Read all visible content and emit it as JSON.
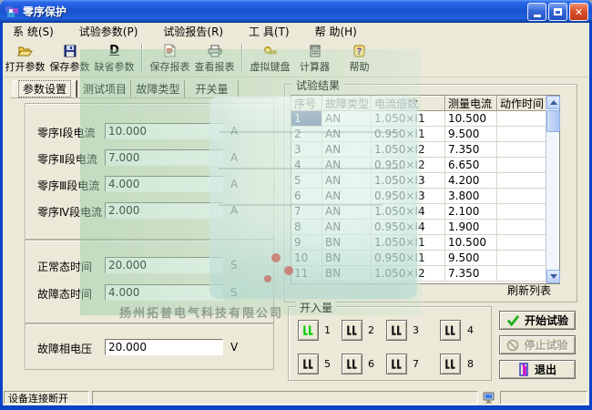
{
  "window": {
    "title": "零序保护"
  },
  "menu": {
    "items": [
      {
        "label": "系 统(S)"
      },
      {
        "label": "试验参数(P)"
      },
      {
        "label": "试验报告(R)"
      },
      {
        "label": "工 具(T)"
      },
      {
        "label": "帮 助(H)"
      }
    ]
  },
  "toolbar": {
    "buttons": [
      {
        "label": "打开参数",
        "icon": "open-folder-icon"
      },
      {
        "label": "保存参数",
        "icon": "save-icon"
      },
      {
        "label": "缺省参数",
        "icon": "default-params-icon"
      },
      {
        "label": "保存报表",
        "icon": "save-report-icon"
      },
      {
        "label": "查看报表",
        "icon": "print-report-icon"
      },
      {
        "label": "虚拟键盘",
        "icon": "virtual-keyboard-icon"
      },
      {
        "label": "计算器",
        "icon": "calculator-icon"
      },
      {
        "label": "帮助",
        "icon": "help-icon"
      }
    ]
  },
  "tabs": [
    {
      "label": "参数设置",
      "active": true
    },
    {
      "label": "测试项目",
      "active": false
    },
    {
      "label": "故障类型",
      "active": false
    },
    {
      "label": "开关量",
      "active": false
    }
  ],
  "params": {
    "current_fields": [
      {
        "label": "零序Ⅰ段电流",
        "value": "10.000",
        "unit": "A"
      },
      {
        "label": "零序Ⅱ段电流",
        "value": "7.000",
        "unit": "A"
      },
      {
        "label": "零序Ⅲ段电流",
        "value": "4.000",
        "unit": "A"
      },
      {
        "label": "零序Ⅳ段电流",
        "value": "2.000",
        "unit": "A"
      }
    ],
    "time_fields": [
      {
        "label": "正常态时间",
        "value": "20.000",
        "unit": "S"
      },
      {
        "label": "故障态时间",
        "value": "4.000",
        "unit": "S"
      }
    ],
    "voltage_fields": [
      {
        "label": "故障相电压",
        "value": "20.000",
        "unit": "V"
      }
    ]
  },
  "results": {
    "title": "试验结果",
    "columns": [
      "序号",
      "故障类型",
      "电流倍数",
      "测量电流",
      "动作时间"
    ],
    "rows": [
      [
        "1",
        "AN",
        "1.050×I1",
        "10.500",
        ""
      ],
      [
        "2",
        "AN",
        "0.950×I1",
        "9.500",
        ""
      ],
      [
        "3",
        "AN",
        "1.050×I2",
        "7.350",
        ""
      ],
      [
        "4",
        "AN",
        "0.950×I2",
        "6.650",
        ""
      ],
      [
        "5",
        "AN",
        "1.050×I3",
        "4.200",
        ""
      ],
      [
        "6",
        "AN",
        "0.950×I3",
        "3.800",
        ""
      ],
      [
        "7",
        "AN",
        "1.050×I4",
        "2.100",
        ""
      ],
      [
        "8",
        "AN",
        "0.950×I4",
        "1.900",
        ""
      ],
      [
        "9",
        "BN",
        "1.050×I1",
        "10.500",
        ""
      ],
      [
        "10",
        "BN",
        "0.950×I1",
        "9.500",
        ""
      ],
      [
        "11",
        "BN",
        "1.050×I2",
        "7.350",
        ""
      ]
    ],
    "refresh_label": "刷新列表"
  },
  "digital_inputs": {
    "title": "开入量",
    "channels": [
      {
        "num": "1",
        "active": true
      },
      {
        "num": "2",
        "active": false
      },
      {
        "num": "3",
        "active": false
      },
      {
        "num": "4",
        "active": false
      },
      {
        "num": "5",
        "active": false
      },
      {
        "num": "6",
        "active": false
      },
      {
        "num": "7",
        "active": false
      },
      {
        "num": "8",
        "active": false
      }
    ]
  },
  "actions": {
    "start": "开始试验",
    "stop": "停止试验",
    "exit": "退出"
  },
  "statusbar": {
    "text": "设备连接断开"
  },
  "watermark": {
    "company": "扬州拓普电气科技有限公司"
  },
  "colors": {
    "titlebar_blue": "#1a53d2",
    "selection_blue": "#0a246a",
    "active_channel_green": "#00cc00",
    "dialog_bg": "#ece9d8"
  }
}
